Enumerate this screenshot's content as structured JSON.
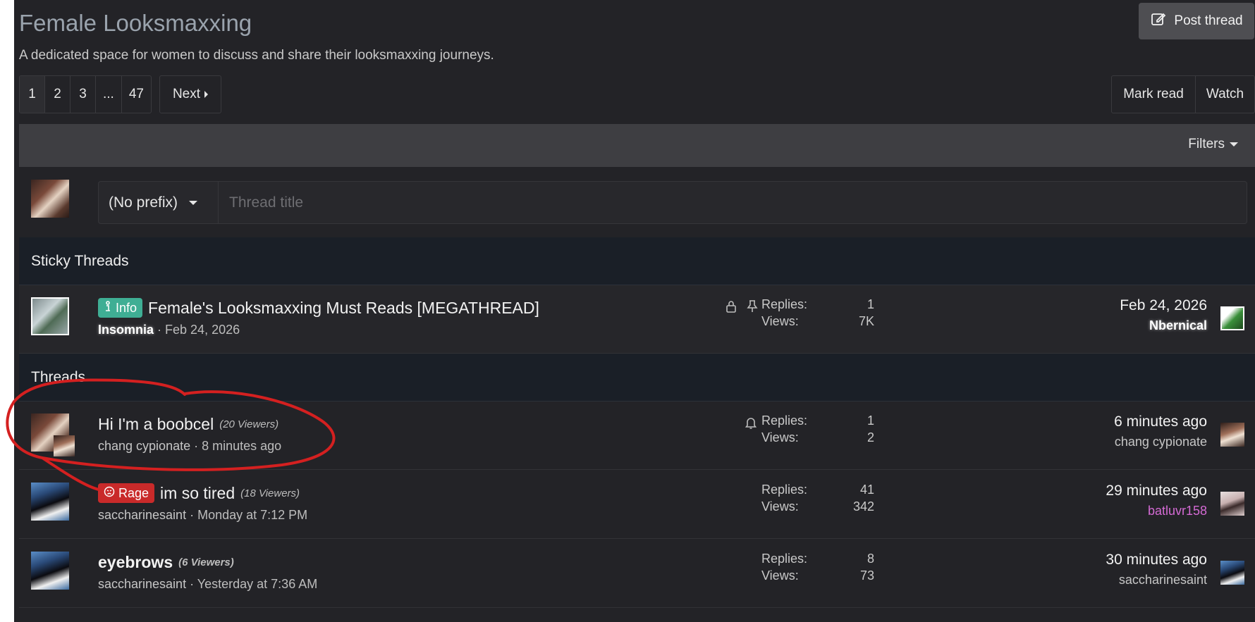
{
  "forum": {
    "title": "Female Looksmaxxing",
    "description": "A dedicated space for women to discuss and share their looksmaxxing journeys.",
    "post_thread_label": "Post thread"
  },
  "pagination": {
    "pages": [
      "1",
      "2",
      "3",
      "...",
      "47"
    ],
    "current": "1",
    "next_label": "Next"
  },
  "actions": {
    "mark_read": "Mark read",
    "watch": "Watch",
    "filters": "Filters"
  },
  "quick_thread": {
    "prefix_value": "(No prefix)",
    "title_placeholder": "Thread title"
  },
  "sections": {
    "sticky": "Sticky Threads",
    "threads": "Threads"
  },
  "sticky_threads": [
    {
      "prefix": "Info",
      "title": "Female's Looksmaxxing Must Reads [MEGATHREAD]",
      "author": "Insomnia",
      "date": "Feb 24, 2026",
      "replies_label": "Replies:",
      "replies": "1",
      "views_label": "Views:",
      "views": "7K",
      "latest_date": "Feb 24, 2026",
      "latest_user": "Nbernical",
      "icons": [
        "lock-icon",
        "pin-icon"
      ]
    }
  ],
  "threads": [
    {
      "title": "Hi I'm a boobcel",
      "viewers": "(20 Viewers)",
      "author": "chang cypionate",
      "date": "8 minutes ago",
      "replies_label": "Replies:",
      "replies": "1",
      "views_label": "Views:",
      "views": "2",
      "latest_date": "6 minutes ago",
      "latest_user": "chang cypionate",
      "icons": [
        "bell-icon"
      ]
    },
    {
      "prefix": "Rage",
      "title": "im so tired",
      "viewers": "(18 Viewers)",
      "author": "saccharinesaint",
      "date": "Monday at 7:12 PM",
      "replies_label": "Replies:",
      "replies": "41",
      "views_label": "Views:",
      "views": "342",
      "latest_date": "29 minutes ago",
      "latest_user": "batluvr158",
      "latest_user_color": "#d46ad4"
    },
    {
      "title": "eyebrows",
      "viewers": "(6 Viewers)",
      "author": "saccharinesaint",
      "date": "Yesterday at 7:36 AM",
      "replies_label": "Replies:",
      "replies": "8",
      "views_label": "Views:",
      "views": "73",
      "latest_date": "30 minutes ago",
      "latest_user": "saccharinesaint"
    }
  ],
  "colors": {
    "background": "#232327",
    "section_header": "#1a1f27",
    "info_label": "#3fae94",
    "rage_label": "#c92a2a",
    "annotation": "#d42020"
  }
}
